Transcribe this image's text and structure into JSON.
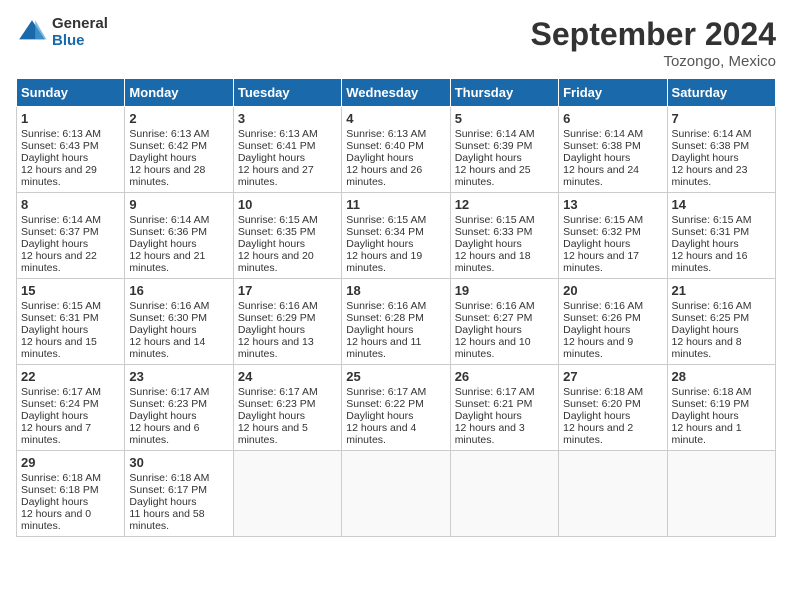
{
  "logo": {
    "general": "General",
    "blue": "Blue"
  },
  "title": "September 2024",
  "location": "Tozongo, Mexico",
  "days_of_week": [
    "Sunday",
    "Monday",
    "Tuesday",
    "Wednesday",
    "Thursday",
    "Friday",
    "Saturday"
  ],
  "weeks": [
    [
      {
        "day": "1",
        "sunrise": "6:13 AM",
        "sunset": "6:43 PM",
        "daylight": "12 hours and 29 minutes."
      },
      {
        "day": "2",
        "sunrise": "6:13 AM",
        "sunset": "6:42 PM",
        "daylight": "12 hours and 28 minutes."
      },
      {
        "day": "3",
        "sunrise": "6:13 AM",
        "sunset": "6:41 PM",
        "daylight": "12 hours and 27 minutes."
      },
      {
        "day": "4",
        "sunrise": "6:13 AM",
        "sunset": "6:40 PM",
        "daylight": "12 hours and 26 minutes."
      },
      {
        "day": "5",
        "sunrise": "6:14 AM",
        "sunset": "6:39 PM",
        "daylight": "12 hours and 25 minutes."
      },
      {
        "day": "6",
        "sunrise": "6:14 AM",
        "sunset": "6:38 PM",
        "daylight": "12 hours and 24 minutes."
      },
      {
        "day": "7",
        "sunrise": "6:14 AM",
        "sunset": "6:38 PM",
        "daylight": "12 hours and 23 minutes."
      }
    ],
    [
      {
        "day": "8",
        "sunrise": "6:14 AM",
        "sunset": "6:37 PM",
        "daylight": "12 hours and 22 minutes."
      },
      {
        "day": "9",
        "sunrise": "6:14 AM",
        "sunset": "6:36 PM",
        "daylight": "12 hours and 21 minutes."
      },
      {
        "day": "10",
        "sunrise": "6:15 AM",
        "sunset": "6:35 PM",
        "daylight": "12 hours and 20 minutes."
      },
      {
        "day": "11",
        "sunrise": "6:15 AM",
        "sunset": "6:34 PM",
        "daylight": "12 hours and 19 minutes."
      },
      {
        "day": "12",
        "sunrise": "6:15 AM",
        "sunset": "6:33 PM",
        "daylight": "12 hours and 18 minutes."
      },
      {
        "day": "13",
        "sunrise": "6:15 AM",
        "sunset": "6:32 PM",
        "daylight": "12 hours and 17 minutes."
      },
      {
        "day": "14",
        "sunrise": "6:15 AM",
        "sunset": "6:31 PM",
        "daylight": "12 hours and 16 minutes."
      }
    ],
    [
      {
        "day": "15",
        "sunrise": "6:15 AM",
        "sunset": "6:31 PM",
        "daylight": "12 hours and 15 minutes."
      },
      {
        "day": "16",
        "sunrise": "6:16 AM",
        "sunset": "6:30 PM",
        "daylight": "12 hours and 14 minutes."
      },
      {
        "day": "17",
        "sunrise": "6:16 AM",
        "sunset": "6:29 PM",
        "daylight": "12 hours and 13 minutes."
      },
      {
        "day": "18",
        "sunrise": "6:16 AM",
        "sunset": "6:28 PM",
        "daylight": "12 hours and 11 minutes."
      },
      {
        "day": "19",
        "sunrise": "6:16 AM",
        "sunset": "6:27 PM",
        "daylight": "12 hours and 10 minutes."
      },
      {
        "day": "20",
        "sunrise": "6:16 AM",
        "sunset": "6:26 PM",
        "daylight": "12 hours and 9 minutes."
      },
      {
        "day": "21",
        "sunrise": "6:16 AM",
        "sunset": "6:25 PM",
        "daylight": "12 hours and 8 minutes."
      }
    ],
    [
      {
        "day": "22",
        "sunrise": "6:17 AM",
        "sunset": "6:24 PM",
        "daylight": "12 hours and 7 minutes."
      },
      {
        "day": "23",
        "sunrise": "6:17 AM",
        "sunset": "6:23 PM",
        "daylight": "12 hours and 6 minutes."
      },
      {
        "day": "24",
        "sunrise": "6:17 AM",
        "sunset": "6:23 PM",
        "daylight": "12 hours and 5 minutes."
      },
      {
        "day": "25",
        "sunrise": "6:17 AM",
        "sunset": "6:22 PM",
        "daylight": "12 hours and 4 minutes."
      },
      {
        "day": "26",
        "sunrise": "6:17 AM",
        "sunset": "6:21 PM",
        "daylight": "12 hours and 3 minutes."
      },
      {
        "day": "27",
        "sunrise": "6:18 AM",
        "sunset": "6:20 PM",
        "daylight": "12 hours and 2 minutes."
      },
      {
        "day": "28",
        "sunrise": "6:18 AM",
        "sunset": "6:19 PM",
        "daylight": "12 hours and 1 minute."
      }
    ],
    [
      {
        "day": "29",
        "sunrise": "6:18 AM",
        "sunset": "6:18 PM",
        "daylight": "12 hours and 0 minutes."
      },
      {
        "day": "30",
        "sunrise": "6:18 AM",
        "sunset": "6:17 PM",
        "daylight": "11 hours and 58 minutes."
      },
      null,
      null,
      null,
      null,
      null
    ]
  ]
}
